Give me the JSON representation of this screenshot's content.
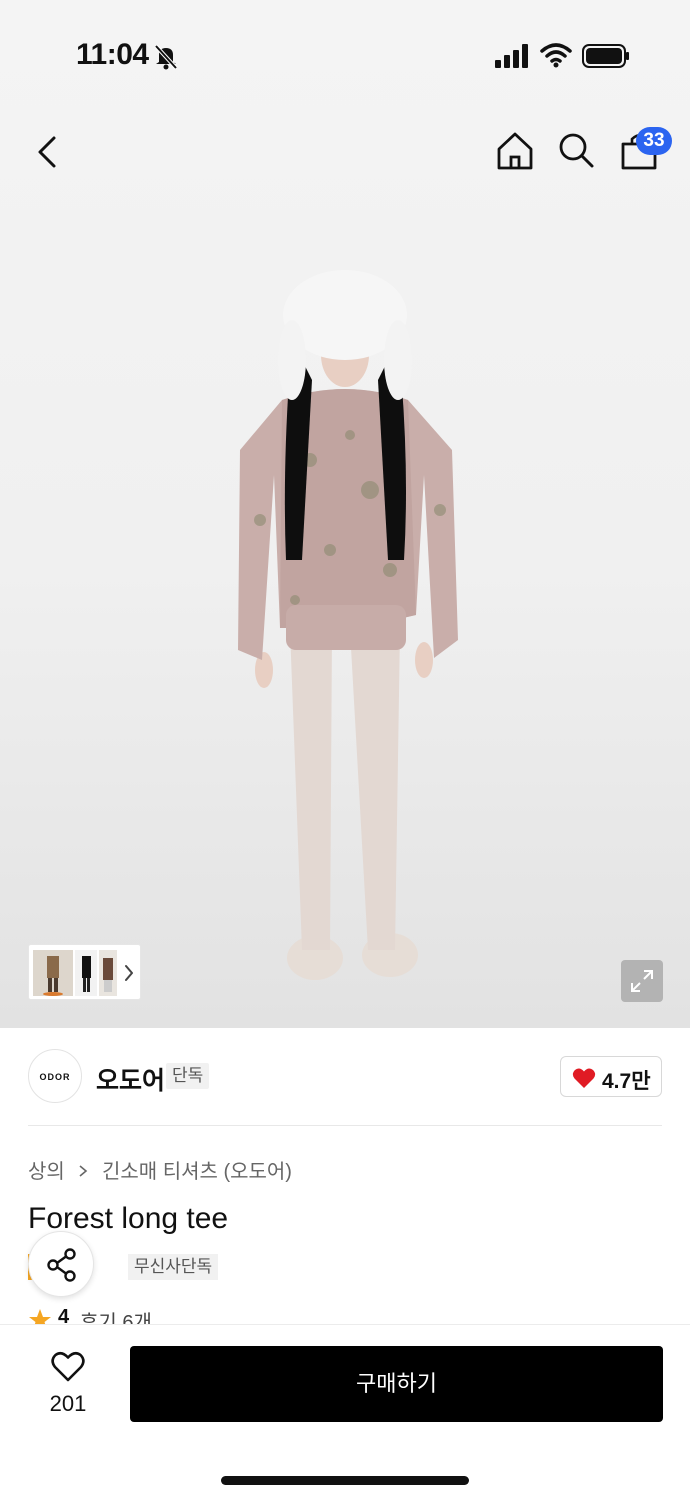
{
  "status_bar": {
    "time": "11:04",
    "icons": [
      "bell-slash-icon",
      "signal-icon",
      "wifi-icon",
      "battery-icon"
    ]
  },
  "nav": {
    "icons": [
      "chevron-left-icon",
      "home-icon",
      "search-icon",
      "shopping-bag-icon"
    ],
    "cart_count": "33",
    "badge_color": "#2b64f0"
  },
  "gallery": {
    "icons": [
      "chevron-right-icon",
      "expand-icon"
    ]
  },
  "brand": {
    "logo_text": "ODOR",
    "name": "오도어",
    "tag": "단독",
    "likes": "4.7만",
    "heart_color": "#e01b24"
  },
  "product": {
    "breadcrumb": [
      "상의",
      "긴소매 티셔츠 (오도어)"
    ],
    "title": "Forest long tee",
    "badges": [
      "일",
      "무신사단독"
    ],
    "badge_accent": "#f5a623",
    "rating": "4",
    "reviews": "후기 6개"
  },
  "bottom": {
    "wishlist_count": "201",
    "buy_label": "구매하기"
  }
}
